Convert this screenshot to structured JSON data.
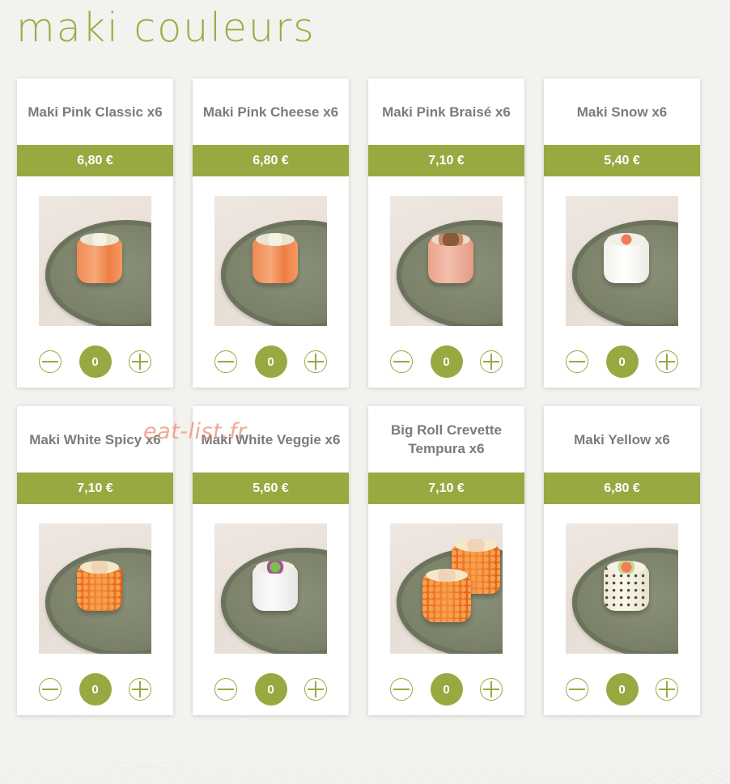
{
  "page": {
    "title": "maki couleurs"
  },
  "watermark": "eat-list.fr",
  "products": [
    {
      "name": "Maki Pink Classic x6",
      "price": "6,80 €",
      "quantity": "0",
      "roll": "salmon"
    },
    {
      "name": "Maki Pink Cheese x6",
      "price": "6,80 €",
      "quantity": "0",
      "roll": "salmon"
    },
    {
      "name": "Maki Pink Braisé x6",
      "price": "7,10 €",
      "quantity": "0",
      "roll": "braise"
    },
    {
      "name": "Maki Snow x6",
      "price": "5,40 €",
      "quantity": "0",
      "roll": "rice"
    },
    {
      "name": "Maki White Spicy x6",
      "price": "7,10 €",
      "quantity": "0",
      "roll": "orange"
    },
    {
      "name": "Maki White Veggie x6",
      "price": "5,60 €",
      "quantity": "0",
      "roll": "veggie"
    },
    {
      "name": "Big Roll Crevette Tempura x6",
      "price": "7,10 €",
      "quantity": "0",
      "roll": "big"
    },
    {
      "name": "Maki Yellow x6",
      "price": "6,80 €",
      "quantity": "0",
      "roll": "yellow"
    }
  ],
  "icons": {
    "decrease": "minus-circle-icon",
    "increase": "plus-circle-icon"
  },
  "colors": {
    "accent": "#98a942",
    "title": "#9aad44",
    "product_name": "#7b7b7b",
    "background": "#f3f2ef",
    "watermark": "#ee8c6e"
  }
}
